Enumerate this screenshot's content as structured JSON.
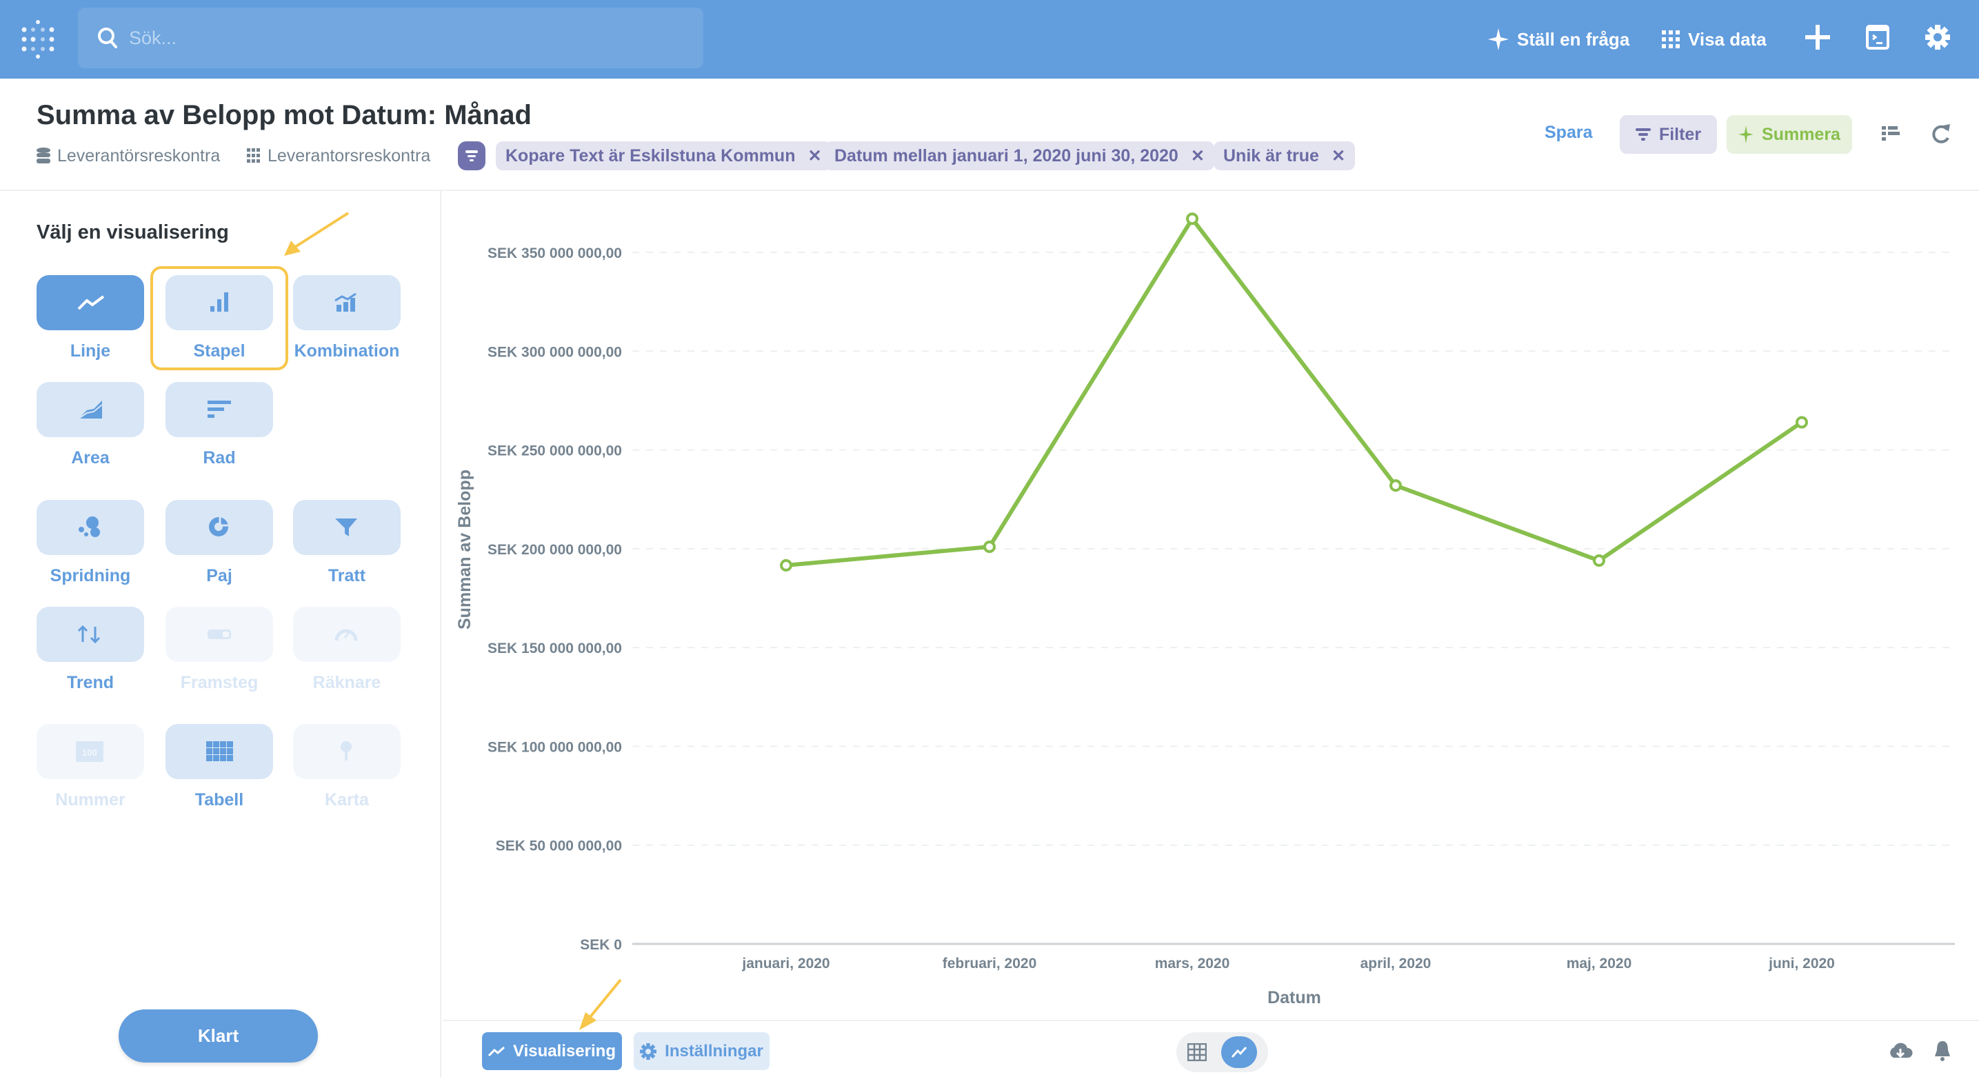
{
  "topbar": {
    "search_placeholder": "Sök...",
    "ask_question": "Ställ en fråga",
    "browse_data": "Visa data"
  },
  "question": {
    "title": "Summa av Belopp mot Datum: Månad",
    "database": "Leverantörsreskontra",
    "table": "Leverantorsreskontra",
    "filters": [
      "Kopare Text är Eskilstuna Kommun",
      "Datum mellan januari 1, 2020 juni 30, 2020",
      "Unik är true"
    ],
    "remove_glyph": "✕",
    "save": "Spara",
    "filter": "Filter",
    "summarize": "Summera"
  },
  "sidebar": {
    "heading": "Välj en visualisering",
    "tiles": [
      {
        "label": "Linje",
        "icon": "line",
        "state": "active"
      },
      {
        "label": "Stapel",
        "icon": "bar",
        "state": "enabled"
      },
      {
        "label": "Kombination",
        "icon": "combo",
        "state": "enabled"
      },
      {
        "label": "Area",
        "icon": "area",
        "state": "enabled"
      },
      {
        "label": "Rad",
        "icon": "row",
        "state": "enabled"
      },
      {
        "label": "Spridning",
        "icon": "scatter",
        "state": "enabled"
      },
      {
        "label": "Paj",
        "icon": "pie",
        "state": "enabled"
      },
      {
        "label": "Tratt",
        "icon": "funnel",
        "state": "enabled"
      },
      {
        "label": "Trend",
        "icon": "trend",
        "state": "enabled"
      },
      {
        "label": "Framsteg",
        "icon": "progress",
        "state": "disabled"
      },
      {
        "label": "Räknare",
        "icon": "gauge",
        "state": "disabled"
      },
      {
        "label": "Nummer",
        "icon": "number",
        "state": "disabled"
      },
      {
        "label": "Tabell",
        "icon": "table",
        "state": "enabled"
      },
      {
        "label": "Karta",
        "icon": "pin",
        "state": "disabled"
      }
    ],
    "number_icon_text": "100",
    "done": "Klart"
  },
  "footer": {
    "visualization": "Visualisering",
    "settings": "Inställningar"
  },
  "colors": {
    "brand": "#629ddd",
    "series": "#88bf4d",
    "highlight": "#f7c64a"
  },
  "chart_data": {
    "type": "line",
    "xlabel": "Datum",
    "ylabel": "Summan av Belopp",
    "categories": [
      "januari, 2020",
      "februari, 2020",
      "mars, 2020",
      "april, 2020",
      "maj, 2020",
      "juni, 2020"
    ],
    "series": [
      {
        "name": "Summa av Belopp",
        "values": [
          191600000,
          201000000,
          367000000,
          232000000,
          194000000,
          264000000
        ]
      }
    ],
    "ylim": [
      0,
      350000000
    ],
    "yticks": [
      0,
      50000000,
      100000000,
      150000000,
      200000000,
      250000000,
      300000000,
      350000000
    ],
    "ytick_labels": [
      "SEK 0",
      "SEK 50 000 000,00",
      "SEK 100 000 000,00",
      "SEK 150 000 000,00",
      "SEK 200 000 000,00",
      "SEK 250 000 000,00",
      "SEK 300 000 000,00",
      "SEK 350 000 000,00"
    ],
    "grid": true
  }
}
